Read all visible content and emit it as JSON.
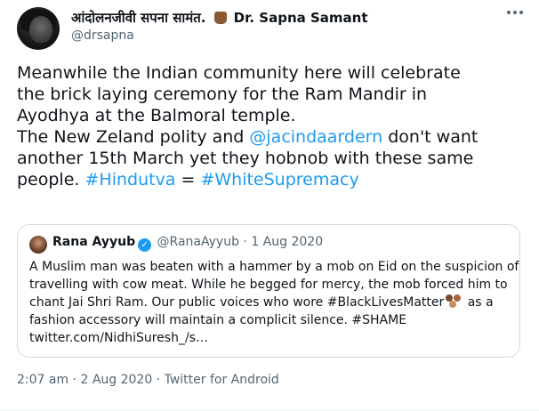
{
  "tweet": {
    "author_name": "आंदोलनजीवी सपना सामंत.",
    "author_name_suffix": "Dr. Sapna Samant",
    "handle": "@drsapna",
    "text_lines": [
      [
        "Meanwhile the Indian community here will celebrate"
      ],
      [
        "the brick laying ceremony for the Ram Mandir in"
      ],
      [
        "Ayodhya at the Balmoral temple."
      ],
      [
        "The New Zeland polity and ",
        "@jacindaardern",
        " don't want"
      ],
      [
        "another 15th March yet they hobnob with these same"
      ],
      [
        "people. ",
        "#Hindutva",
        " = ",
        "#WhiteSupremacy"
      ]
    ],
    "timestamp": "2:07 am · 2 Aug 2020",
    "separator": " · ",
    "source": "Twitter for Android"
  },
  "quote": {
    "name": "Rana Ayyub",
    "handle": "@RanaAyyub",
    "date": "1 Aug 2020",
    "text": {
      "line1": "A Muslim man was beaten with a hammer  by a mob on Eid on the suspicion of",
      "line2": "travelling with cow meat. While he begged for mercy, the mob forced him to",
      "line3": "chant Jai Shri Ram. Our public voices who wore ",
      "hashtag": "#BlackLivesMatter",
      "line3_end": " as a",
      "line4": "fashion accessory will maintain a complicit silence. #SHAME",
      "line5": "twitter.com/NidhiSuresh_/s…"
    }
  },
  "colors": {
    "link": "#1d9bf0",
    "text": "#0f1419",
    "secondary": "#536471",
    "border": "#cfd9de"
  },
  "icons": {
    "more": "more-options-icon",
    "verified": "verified-badge-icon",
    "fist": "raised-fist-emoji",
    "hands": "raised-hands-emoji"
  }
}
